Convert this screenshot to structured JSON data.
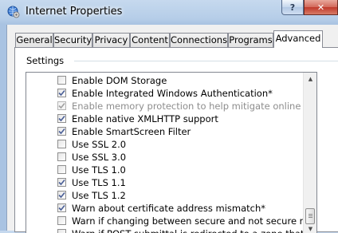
{
  "window": {
    "title": "Internet Properties",
    "help_label": "?",
    "close_label": "✕"
  },
  "tabs": [
    {
      "label": "General",
      "active": false
    },
    {
      "label": "Security",
      "active": false
    },
    {
      "label": "Privacy",
      "active": false
    },
    {
      "label": "Content",
      "active": false
    },
    {
      "label": "Connections",
      "active": false
    },
    {
      "label": "Programs",
      "active": false
    },
    {
      "label": "Advanced",
      "active": true
    }
  ],
  "settings": {
    "group_label": "Settings",
    "items": [
      {
        "label": "Enable DOM Storage",
        "checked": false,
        "enabled": true
      },
      {
        "label": "Enable Integrated Windows Authentication*",
        "checked": true,
        "enabled": true
      },
      {
        "label": "Enable memory protection to help mitigate online attacks*",
        "checked": true,
        "enabled": false
      },
      {
        "label": "Enable native XMLHTTP support",
        "checked": true,
        "enabled": true
      },
      {
        "label": "Enable SmartScreen Filter",
        "checked": true,
        "enabled": true
      },
      {
        "label": "Use SSL 2.0",
        "checked": false,
        "enabled": true
      },
      {
        "label": "Use SSL 3.0",
        "checked": false,
        "enabled": true
      },
      {
        "label": "Use TLS 1.0",
        "checked": false,
        "enabled": true
      },
      {
        "label": "Use TLS 1.1",
        "checked": true,
        "enabled": true
      },
      {
        "label": "Use TLS 1.2",
        "checked": true,
        "enabled": true
      },
      {
        "label": "Warn about certificate address mismatch*",
        "checked": true,
        "enabled": true
      },
      {
        "label": "Warn if changing between secure and not secure mode",
        "checked": false,
        "enabled": true
      },
      {
        "label": "Warn if POST submittal is redirected to a zone that does not permit posts",
        "checked": false,
        "enabled": true
      }
    ]
  },
  "scrollbar": {
    "up_glyph": "▲",
    "down_glyph": "▼",
    "position": 0.9
  }
}
